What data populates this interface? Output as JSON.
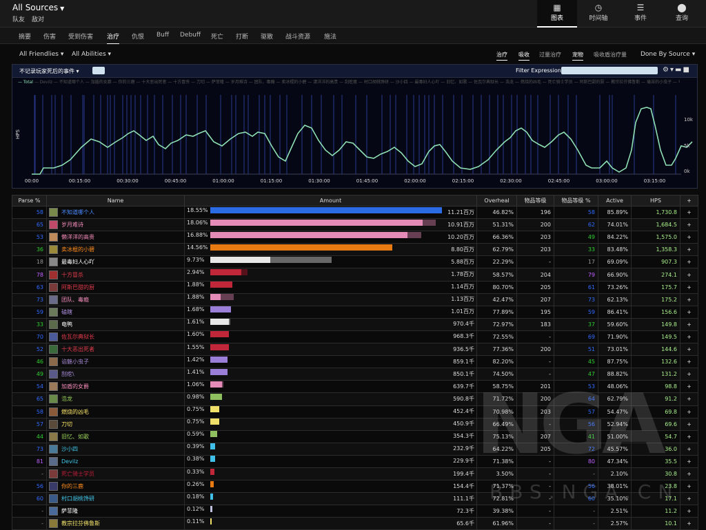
{
  "header": {
    "title": "All Sources",
    "subtitle": [
      "队友",
      "敌对"
    ],
    "nav": [
      {
        "icon": "table-icon",
        "label": "图表"
      },
      {
        "icon": "clock-icon",
        "label": "时间轴"
      },
      {
        "icon": "list-icon",
        "label": "事件"
      },
      {
        "icon": "pin-icon",
        "label": "查询"
      }
    ]
  },
  "tabs": [
    "摘要",
    "伤害",
    "受到伤害",
    "治疗",
    "仇恨",
    "Buff",
    "Debuff",
    "死亡",
    "打断",
    "驱散",
    "战斗资源",
    "施法"
  ],
  "filters": {
    "friendlies": "All Friendlies",
    "abilities": "All Abilities",
    "right": [
      "治疗",
      "吸收",
      "过量治疗",
      "宠物",
      "吸收盾治疗量"
    ],
    "done_by": "Done By Source"
  },
  "graph": {
    "event_select": "不记录玩家死后的事件",
    "filter_label": "Filter Expression:",
    "legend": [
      "Total",
      "Devilz",
      "不知道哪个人",
      "加盾的女爵",
      "你的三鹿",
      "十大恶出死者",
      "十方冒杀",
      "刀切",
      "萨菲隆",
      "岁月难诗",
      "团队、毒瘾",
      "卖冰棍的小碧",
      "漾洋洋的高贵",
      "刮疙瘩",
      "村口胡桃馋研",
      "沙小四",
      "最毒妇人心吖",
      "旧忆、如歌",
      "佐瓦尔典狱长",
      "浩龙",
      "燃烧的凶毛",
      "死亡骑士学员",
      "阿斯巴甜的厨",
      "教宗拉芬佛鲁斯",
      "痛苦的小虫子",
      "电鸭",
      "磕瞎",
      "疯狂的黑手",
      "精华的小姐",
      "谄媚之鬼",
      "蛊惑之钞",
      "美杜莎之目",
      "神兽降临",
      "黑魔侍者"
    ],
    "ylabel": "HPS",
    "yticks": [
      "10k",
      "5k",
      "0k"
    ],
    "xticks": [
      "00:00",
      "00:15:00",
      "00:30:00",
      "00:45:00",
      "01:00:00",
      "01:15:00",
      "01:30:00",
      "01:45:00",
      "02:00:00",
      "02:15:00",
      "02:30:00",
      "02:45:00",
      "03:00:00",
      "03:15:00"
    ],
    "colors": {
      "line": "#8fe0b5",
      "markers": "#2c3f9c"
    }
  },
  "table": {
    "headers": [
      "Parse %",
      "Name",
      "Amount",
      "Overheal",
      "物品等级",
      "物品等级 %",
      "Active",
      "HPS",
      "+"
    ],
    "rows": [
      {
        "parse": "58",
        "pc": "#2f6bff",
        "name": "不知道哪个人",
        "nc": "#4a8cff",
        "av": "#7a8a4a",
        "pct": "18.55%",
        "amount": "11.21百万",
        "f": 1.0,
        "f2": 0,
        "bc": "#2b6be3",
        "overheal": "46.82%",
        "ilvl": "196",
        "ipct": "58",
        "ipc": "#2f6bff",
        "active": "85.89%",
        "hps": "1,730.8"
      },
      {
        "parse": "65",
        "pc": "#2f6bff",
        "name": "岁月难诗",
        "nc": "#f48cba",
        "av": "#c04a6a",
        "pct": "18.06%",
        "amount": "10.91百万",
        "f": 0.918,
        "f2": 0.055,
        "bc": "#e58bb8",
        "overheal": "51.31%",
        "ilvl": "200",
        "ipct": "62",
        "ipc": "#2f6bff",
        "active": "74.01%",
        "hps": "1,684.5"
      },
      {
        "parse": "53",
        "pc": "#2f6bff",
        "name": "懒洋洋的高贵",
        "nc": "#f48cba",
        "av": "#c08a5a",
        "pct": "16.88%",
        "amount": "10.20百万",
        "f": 0.85,
        "f2": 0.062,
        "bc": "#e58bb8",
        "overheal": "66.36%",
        "ilvl": "203",
        "ipct": "49",
        "ipc": "#2fd12f",
        "active": "84.22%",
        "hps": "1,575.0"
      },
      {
        "parse": "36",
        "pc": "#2fd12f",
        "name": "卖冰棍的小碧",
        "nc": "#ff8c1a",
        "av": "#9a8a3a",
        "pct": "14.56%",
        "amount": "8.80百万",
        "f": 0.785,
        "f2": 0,
        "bc": "#e87a12",
        "overheal": "62.79%",
        "ilvl": "203",
        "ipct": "33",
        "ipc": "#2fd12f",
        "active": "83.48%",
        "hps": "1,358.3"
      },
      {
        "parse": "18",
        "pc": "#999",
        "name": "最毒妇人心吖",
        "nc": "#ffffff",
        "av": "#888",
        "pct": "9.73%",
        "amount": "5.88百万",
        "f": 0.26,
        "f2": 0.265,
        "bc": "#e8e8e8",
        "overheal": "22.29%",
        "ilvl": "-",
        "ipct": "17",
        "ipc": "#999",
        "active": "69.09%",
        "hps": "907.3"
      },
      {
        "parse": "78",
        "pc": "#c060ff",
        "name": "十方冒杀",
        "nc": "#e03a4a",
        "av": "#a03030",
        "pct": "2.94%",
        "amount": "1.78百万",
        "f": 0.135,
        "f2": 0.025,
        "bc": "#c0283a",
        "overheal": "58.57%",
        "ilvl": "204",
        "ipct": "79",
        "ipc": "#c060ff",
        "active": "66.90%",
        "hps": "274.1"
      },
      {
        "parse": "63",
        "pc": "#2f6bff",
        "name": "阿斯巴甜的厨",
        "nc": "#e03a4a",
        "av": "#7a3a3a",
        "pct": "1.88%",
        "amount": "1.14百万",
        "f": 0.095,
        "f2": 0,
        "bc": "#c0283a",
        "overheal": "80.70%",
        "ilvl": "205",
        "ipct": "61",
        "ipc": "#2f6bff",
        "active": "73.26%",
        "hps": "175.7"
      },
      {
        "parse": "73",
        "pc": "#2f6bff",
        "name": "团队、毒瘾",
        "nc": "#f48cba",
        "av": "#6a6a8a",
        "pct": "1.88%",
        "amount": "1.13百万",
        "f": 0.045,
        "f2": 0.055,
        "bc": "#e58bb8",
        "overheal": "42.47%",
        "ilvl": "207",
        "ipct": "73",
        "ipc": "#2f6bff",
        "active": "62.13%",
        "hps": "175.2"
      },
      {
        "parse": "59",
        "pc": "#2f6bff",
        "name": "磕瞎",
        "nc": "#a88bd8",
        "av": "#6a7a5a",
        "pct": "1.68%",
        "amount": "1.01百万",
        "f": 0.09,
        "f2": 0,
        "bc": "#9b7ed8",
        "overheal": "77.89%",
        "ilvl": "195",
        "ipct": "59",
        "ipc": "#2f6bff",
        "active": "86.41%",
        "hps": "156.6"
      },
      {
        "parse": "33",
        "pc": "#2fd12f",
        "name": "电鸭",
        "nc": "#ffffff",
        "av": "#5a6a4a",
        "pct": "1.61%",
        "amount": "970.4千",
        "f": 0.08,
        "f2": 0.005,
        "bc": "#e8e8e8",
        "overheal": "72.97%",
        "ilvl": "183",
        "ipct": "37",
        "ipc": "#2fd12f",
        "active": "59.60%",
        "hps": "149.8"
      },
      {
        "parse": "70",
        "pc": "#2f6bff",
        "name": "佐瓦尔典狱长",
        "nc": "#e03a4a",
        "av": "#4a5a9a",
        "pct": "1.60%",
        "amount": "968.3千",
        "f": 0.08,
        "f2": 0,
        "bc": "#c0283a",
        "overheal": "72.55%",
        "ilvl": "-",
        "ipct": "69",
        "ipc": "#2f6bff",
        "active": "71.90%",
        "hps": "149.5"
      },
      {
        "parse": "52",
        "pc": "#2f6bff",
        "name": "十大恶出死者",
        "nc": "#e03a4a",
        "av": "#3a6a3a",
        "pct": "1.55%",
        "amount": "936.5千",
        "f": 0.08,
        "f2": 0,
        "bc": "#c0283a",
        "overheal": "77.36%",
        "ilvl": "200",
        "ipct": "51",
        "ipc": "#2f6bff",
        "active": "73.01%",
        "hps": "144.6"
      },
      {
        "parse": "46",
        "pc": "#2fd12f",
        "name": "谄魅小虫子",
        "nc": "#a88bd8",
        "av": "#8a6a4a",
        "pct": "1.42%",
        "amount": "859.1千",
        "f": 0.075,
        "f2": 0,
        "bc": "#9b7ed8",
        "overheal": "82.20%",
        "ilvl": "-",
        "ipct": "45",
        "ipc": "#2fd12f",
        "active": "87.75%",
        "hps": "132.6"
      },
      {
        "parse": "49",
        "pc": "#2fd12f",
        "name": "刮疙\\",
        "nc": "#a88bd8",
        "av": "#5a5a8a",
        "pct": "1.41%",
        "amount": "850.1千",
        "f": 0.075,
        "f2": 0,
        "bc": "#9b7ed8",
        "overheal": "74.50%",
        "ilvl": "-",
        "ipct": "47",
        "ipc": "#2fd12f",
        "active": "88.82%",
        "hps": "131.2"
      },
      {
        "parse": "54",
        "pc": "#2f6bff",
        "name": "加盾的女爵",
        "nc": "#f48cba",
        "av": "#9a7a5a",
        "pct": "1.06%",
        "amount": "639.7千",
        "f": 0.05,
        "f2": 0.006,
        "bc": "#e58bb8",
        "overheal": "58.75%",
        "ilvl": "201",
        "ipct": "53",
        "ipc": "#2f6bff",
        "active": "48.06%",
        "hps": "98.8"
      },
      {
        "parse": "65",
        "pc": "#2f6bff",
        "name": "浩龙",
        "nc": "#9bd35a",
        "av": "#6a8a4a",
        "pct": "0.98%",
        "amount": "590.8千",
        "f": 0.05,
        "f2": 0,
        "bc": "#8fc060",
        "overheal": "71.72%",
        "ilvl": "200",
        "ipct": "64",
        "ipc": "#2f6bff",
        "active": "62.79%",
        "hps": "91.2"
      },
      {
        "parse": "58",
        "pc": "#2f6bff",
        "name": "燃烧的凶毛",
        "nc": "#ffe86a",
        "av": "#8a5a3a",
        "pct": "0.75%",
        "amount": "452.4千",
        "f": 0.04,
        "f2": 0,
        "bc": "#f0e06a",
        "overheal": "70.98%",
        "ilvl": "203",
        "ipct": "57",
        "ipc": "#2f6bff",
        "active": "54.47%",
        "hps": "69.8"
      },
      {
        "parse": "57",
        "pc": "#2f6bff",
        "name": "刀切",
        "nc": "#ffe86a",
        "av": "#5a4a3a",
        "pct": "0.75%",
        "amount": "450.9千",
        "f": 0.04,
        "f2": 0,
        "bc": "#f0e06a",
        "overheal": "66.49%",
        "ilvl": "-",
        "ipct": "56",
        "ipc": "#2f6bff",
        "active": "52.94%",
        "hps": "69.6"
      },
      {
        "parse": "44",
        "pc": "#2fd12f",
        "name": "旧忆、如歌",
        "nc": "#9bd35a",
        "av": "#8a7a4a",
        "pct": "0.59%",
        "amount": "354.3千",
        "f": 0.03,
        "f2": 0,
        "bc": "#8fc060",
        "overheal": "75.13%",
        "ilvl": "207",
        "ipct": "41",
        "ipc": "#2fd12f",
        "active": "51.00%",
        "hps": "54.7"
      },
      {
        "parse": "73",
        "pc": "#2f6bff",
        "name": "沙小四",
        "nc": "#40c7eb",
        "av": "#4a7a9a",
        "pct": "0.39%",
        "amount": "232.9千",
        "f": 0.02,
        "f2": 0,
        "bc": "#40c0e8",
        "overheal": "64.22%",
        "ilvl": "205",
        "ipct": "72",
        "ipc": "#2f6bff",
        "active": "45.57%",
        "hps": "36.0"
      },
      {
        "parse": "81",
        "pc": "#c060ff",
        "name": "Devilz",
        "nc": "#40c7eb",
        "av": "#5a6a8a",
        "pct": "0.38%",
        "amount": "229.9千",
        "f": 0.02,
        "f2": 0,
        "bc": "#40c0e8",
        "overheal": "71.38%",
        "ilvl": "-",
        "ipct": "80",
        "ipc": "#c060ff",
        "active": "47.34%",
        "hps": "35.5"
      },
      {
        "parse": "-",
        "pc": "#999",
        "name": "死亡骑士学员",
        "nc": "#c41e3a",
        "av": "#7a3a3a",
        "pct": "0.33%",
        "amount": "199.4千",
        "f": 0.018,
        "f2": 0,
        "bc": "#c0283a",
        "overheal": "3.50%",
        "ilvl": "-",
        "ipct": "-",
        "ipc": "#999",
        "active": "2.10%",
        "hps": "30.8"
      },
      {
        "parse": "56",
        "pc": "#2f6bff",
        "name": "你的三鹿",
        "nc": "#ff8c1a",
        "av": "#3a3a6a",
        "pct": "0.26%",
        "amount": "154.4千",
        "f": 0.015,
        "f2": 0,
        "bc": "#e87a12",
        "overheal": "71.37%",
        "ilvl": "-",
        "ipct": "56",
        "ipc": "#2f6bff",
        "active": "38.01%",
        "hps": "23.8"
      },
      {
        "parse": "60",
        "pc": "#2f6bff",
        "name": "村口胡桃馋研",
        "nc": "#40c7eb",
        "av": "#3a5a8a",
        "pct": "0.18%",
        "amount": "111.1千",
        "f": 0.012,
        "f2": 0,
        "bc": "#40c0e8",
        "overheal": "72.81%",
        "ilvl": "-",
        "ipct": "60",
        "ipc": "#2f6bff",
        "active": "35.10%",
        "hps": "17.1"
      },
      {
        "parse": "-",
        "pc": "#999",
        "name": "萨菲隆",
        "nc": "#ffffff",
        "av": "#4a6a9a",
        "pct": "0.12%",
        "amount": "72.3千",
        "f": 0.008,
        "f2": 0,
        "bc": "#c0c0e0",
        "overheal": "39.38%",
        "ilvl": "-",
        "ipct": "-",
        "ipc": "#999",
        "active": "2.51%",
        "hps": "11.2"
      },
      {
        "parse": "-",
        "pc": "#999",
        "name": "教宗拉芬佛鲁斯",
        "nc": "#f0e06a",
        "av": "#8a7a3a",
        "pct": "0.11%",
        "amount": "65.6千",
        "f": 0.007,
        "f2": 0,
        "bc": "#f0e06a",
        "overheal": "61.96%",
        "ilvl": "-",
        "ipct": "-",
        "ipc": "#999",
        "active": "2.57%",
        "hps": "10.1"
      }
    ]
  },
  "watermark": {
    "big": "NGA",
    "small": "BBS.NGA.CN"
  }
}
